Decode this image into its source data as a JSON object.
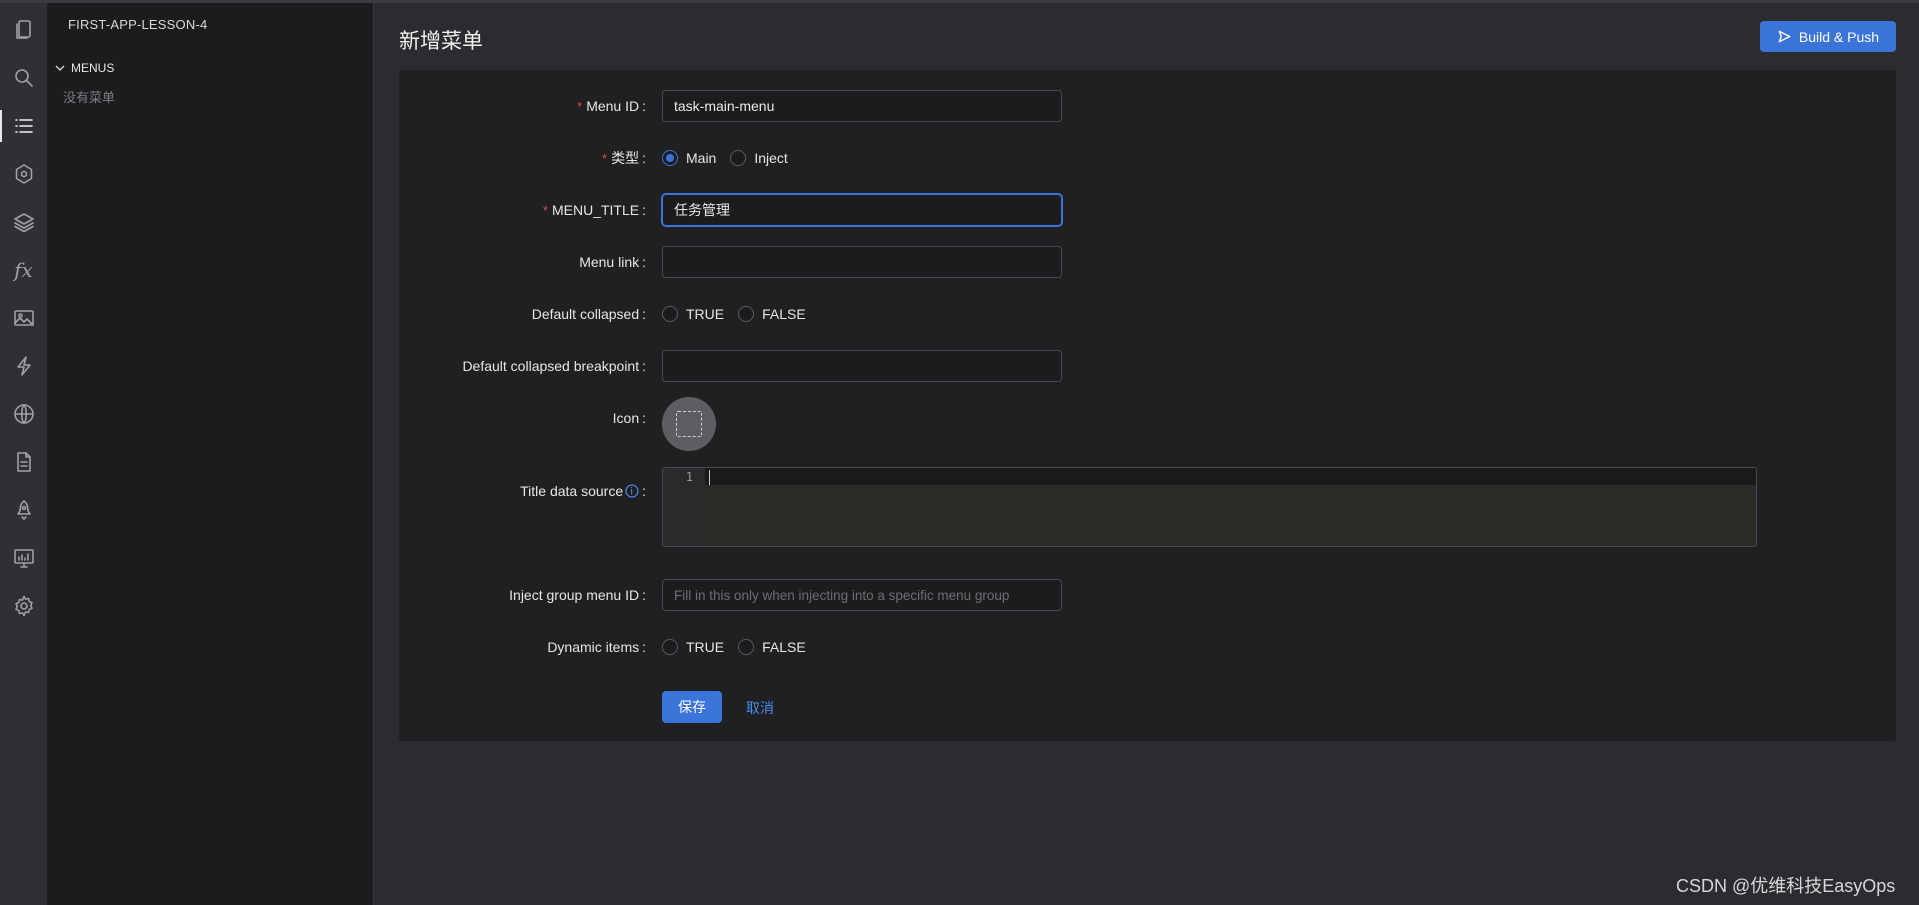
{
  "explorer": {
    "project_name": "FIRST-APP-LESSON-4",
    "section_label": "MENUS",
    "empty_text": "没有菜单"
  },
  "activity_bar": {
    "items": [
      {
        "icon": "pages-icon"
      },
      {
        "icon": "search-icon"
      },
      {
        "icon": "menu-list-icon",
        "active": true
      },
      {
        "icon": "settings-hex-icon"
      },
      {
        "icon": "layers-icon"
      },
      {
        "icon": "fx-icon",
        "text": "fx"
      },
      {
        "icon": "image-icon"
      },
      {
        "icon": "lightning-icon"
      },
      {
        "icon": "globe-icon"
      },
      {
        "icon": "document-icon"
      },
      {
        "icon": "rocket-icon"
      },
      {
        "icon": "monitor-icon"
      },
      {
        "icon": "gear-icon"
      }
    ]
  },
  "header": {
    "title": "新增菜单",
    "build_button_label": "Build & Push"
  },
  "form": {
    "menu_id": {
      "label": "Menu ID",
      "value": "task-main-menu",
      "required": true
    },
    "type": {
      "label": "类型",
      "required": true,
      "options": [
        "Main",
        "Inject"
      ],
      "selected": "Main"
    },
    "menu_title": {
      "label": "MENU_TITLE",
      "value": "任务管理",
      "required": true
    },
    "menu_link": {
      "label": "Menu link",
      "value": ""
    },
    "default_collapsed": {
      "label": "Default collapsed",
      "options": [
        "TRUE",
        "FALSE"
      ],
      "selected": null
    },
    "default_collapsed_breakpoint": {
      "label": "Default collapsed breakpoint",
      "value": ""
    },
    "icon": {
      "label": "Icon"
    },
    "title_data_source": {
      "label": "Title data source",
      "line_number": "1",
      "value": ""
    },
    "inject_group_menu_id": {
      "label": "Inject group menu ID",
      "placeholder": "Fill in this only when injecting into a specific menu group"
    },
    "dynamic_items": {
      "label": "Dynamic items",
      "options": [
        "TRUE",
        "FALSE"
      ],
      "selected": null
    },
    "save_label": "保存",
    "cancel_label": "取消"
  },
  "colon": ":",
  "watermark": "CSDN @优维科技EasyOps",
  "colors": {
    "accent": "#3b74d9",
    "background": "#2b2b30",
    "card": "#202022",
    "sidebar": "#1c1c1e",
    "required": "#e5484d"
  }
}
